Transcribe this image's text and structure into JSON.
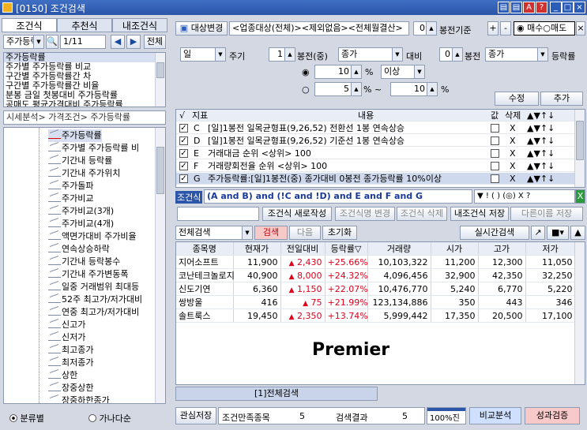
{
  "window": {
    "title": "[0150] 조건검색",
    "buttons": [
      "▤",
      "▤",
      "A",
      "?",
      "_",
      "□",
      "×"
    ]
  },
  "left": {
    "tabs": [
      "조건식",
      "추천식",
      "내조건식"
    ],
    "category_select": "주가등락률",
    "page": "1/11",
    "all_btn": "전체",
    "list": [
      "주가등락률",
      "주가별 주가등락률 비교",
      "구간별 주가등락률간 차",
      "구간별 주가등락률간 비율",
      "분봉 금일 첫봉대비 주가등락률",
      "공매도 평균가격대비 주가등락률"
    ],
    "breadcrumb": "시세분석> 가격조건> 주가등락률",
    "tree": [
      "주가등락률",
      "주가별 주가등락률 비",
      "기간내 등락률",
      "기간내 주가위치",
      "주가돌파",
      "주가비교",
      "주가비교(3개)",
      "주가비교(4개)",
      "액면가대비 주가비율",
      "연속상승하락",
      "기간내 등락봉수",
      "기간내 주가변동폭",
      "일중 거래범위 최대등",
      "52주 최고가/저가대비",
      "연중 최고가/저가대비",
      "신고가",
      "신저가",
      "최고종가",
      "최저종가",
      "상한",
      "장중상한",
      "장중하한종가"
    ],
    "radio1": "분류별",
    "radio2": "가나다순"
  },
  "top": {
    "change_btn": "대상변경",
    "target": "<업종대상(전체)><제외없음><전체월결산>",
    "bong_val": "0",
    "bong_label": "봉전기준",
    "plus": "+",
    "minus": "-",
    "buy": "매수",
    "sell": "매도"
  },
  "params": {
    "period": "일",
    "period_label": "주기",
    "v1": "1",
    "bong_mid": "봉전(중)",
    "price1": "종가",
    "compare": "대비",
    "v2": "0",
    "bong2": "봉전",
    "price2": "종가",
    "rate": "등락률",
    "val1": "10",
    "pct1": "%",
    "cond1": "이상",
    "val2": "5",
    "pct2": "%",
    "tilde": "~",
    "val3": "10",
    "pct3": "%",
    "edit": "수정",
    "add": "추가"
  },
  "conditions": {
    "headers": {
      "check": "√",
      "id": "지표",
      "content": "내용",
      "val": "값",
      "del": "삭제"
    },
    "rows": [
      {
        "id": "C",
        "text": "[일]1봉전 일목균형표(9,26,52) 전환선 1봉 연속상승"
      },
      {
        "id": "D",
        "text": "[일]1봉전 일목균형표(9,26,52) 기준선 1봉 연속상승"
      },
      {
        "id": "E",
        "text": "거래대금 순위 <상위> 100"
      },
      {
        "id": "F",
        "text": "거래량회전율 순위 <상위> 100"
      },
      {
        "id": "G",
        "text": "주가등락률:[일]1봉전(중) 종가대비 0봉전 종가등락률 10%이상"
      }
    ],
    "x": "X",
    "arrows": "▲▼↑↓"
  },
  "formula": {
    "label": "조건식",
    "expr": "(A and B) and (!C and !D) and E and F and G",
    "ops": "▼ ! ( ) (◎) X ? "
  },
  "actions": {
    "new": "조건식 새로작성",
    "modify": "조건식명 변경",
    "delete": "조건식 삭제",
    "save": "내조건식 저장",
    "saveas": "다른이름 저장"
  },
  "search": {
    "scope": "전체검색",
    "search": "검색",
    "next": "다음",
    "reset": "초기화",
    "realtime": "실시간검색"
  },
  "result": {
    "headers": [
      "종목명",
      "현재가",
      "전일대비",
      "등락률▽",
      "거래량",
      "시가",
      "고가",
      "저가"
    ],
    "rows": [
      [
        "지어소프트",
        "11,900",
        "2,430",
        "+25.66%",
        "10,103,322",
        "11,200",
        "12,300",
        "11,050"
      ],
      [
        "코난테크놀로지",
        "40,900",
        "8,000",
        "+24.32%",
        "4,096,456",
        "32,900",
        "42,350",
        "32,250"
      ],
      [
        "신도기연",
        "6,360",
        "1,150",
        "+22.07%",
        "10,476,770",
        "5,240",
        "6,770",
        "5,220"
      ],
      [
        "쌍방울",
        "416",
        "75",
        "+21.99%",
        "123,134,886",
        "350",
        "443",
        "346"
      ],
      [
        "솔트룩스",
        "19,450",
        "2,350",
        "+13.74%",
        "5,999,442",
        "17,350",
        "20,500",
        "17,100"
      ]
    ],
    "watermark": "Premier",
    "tab": "[1]전체검색"
  },
  "status": {
    "save": "관심저장",
    "cond_label": "조건만족종목",
    "cond_count": "5",
    "result_label": "검색결과",
    "result_count": "5",
    "progress": "100%진행",
    "progress_value": 1.0,
    "compare": "비교분석",
    "perf": "성과검증"
  }
}
